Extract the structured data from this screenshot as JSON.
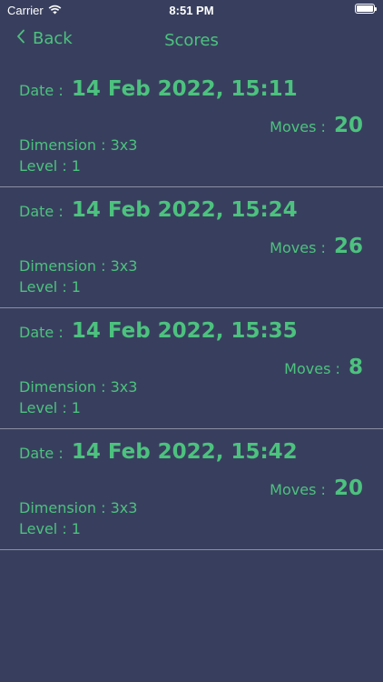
{
  "status": {
    "carrier": "Carrier",
    "time": "8:51 PM",
    "battery_level": 1.0,
    "wifi_icon": "wifi-icon",
    "battery_icon": "battery-icon"
  },
  "nav": {
    "back_label": "Back",
    "back_icon": "chevron-left-icon",
    "title": "Scores"
  },
  "labels": {
    "date": "Date :",
    "moves": "Moves :",
    "dimension": "Dimension : ",
    "level": "Level : "
  },
  "scores": [
    {
      "date": "14 Feb 2022, 15:11",
      "moves": "20",
      "dimension": "3x3",
      "level": "1"
    },
    {
      "date": "14 Feb 2022, 15:24",
      "moves": "26",
      "dimension": "3x3",
      "level": "1"
    },
    {
      "date": "14 Feb 2022, 15:35",
      "moves": "8",
      "dimension": "3x3",
      "level": "1"
    },
    {
      "date": "14 Feb 2022, 15:42",
      "moves": "20",
      "dimension": "3x3",
      "level": "1"
    }
  ],
  "colors": {
    "background": "#383f5e",
    "accent": "#4cc27e",
    "divider": "#8b8fa3"
  }
}
